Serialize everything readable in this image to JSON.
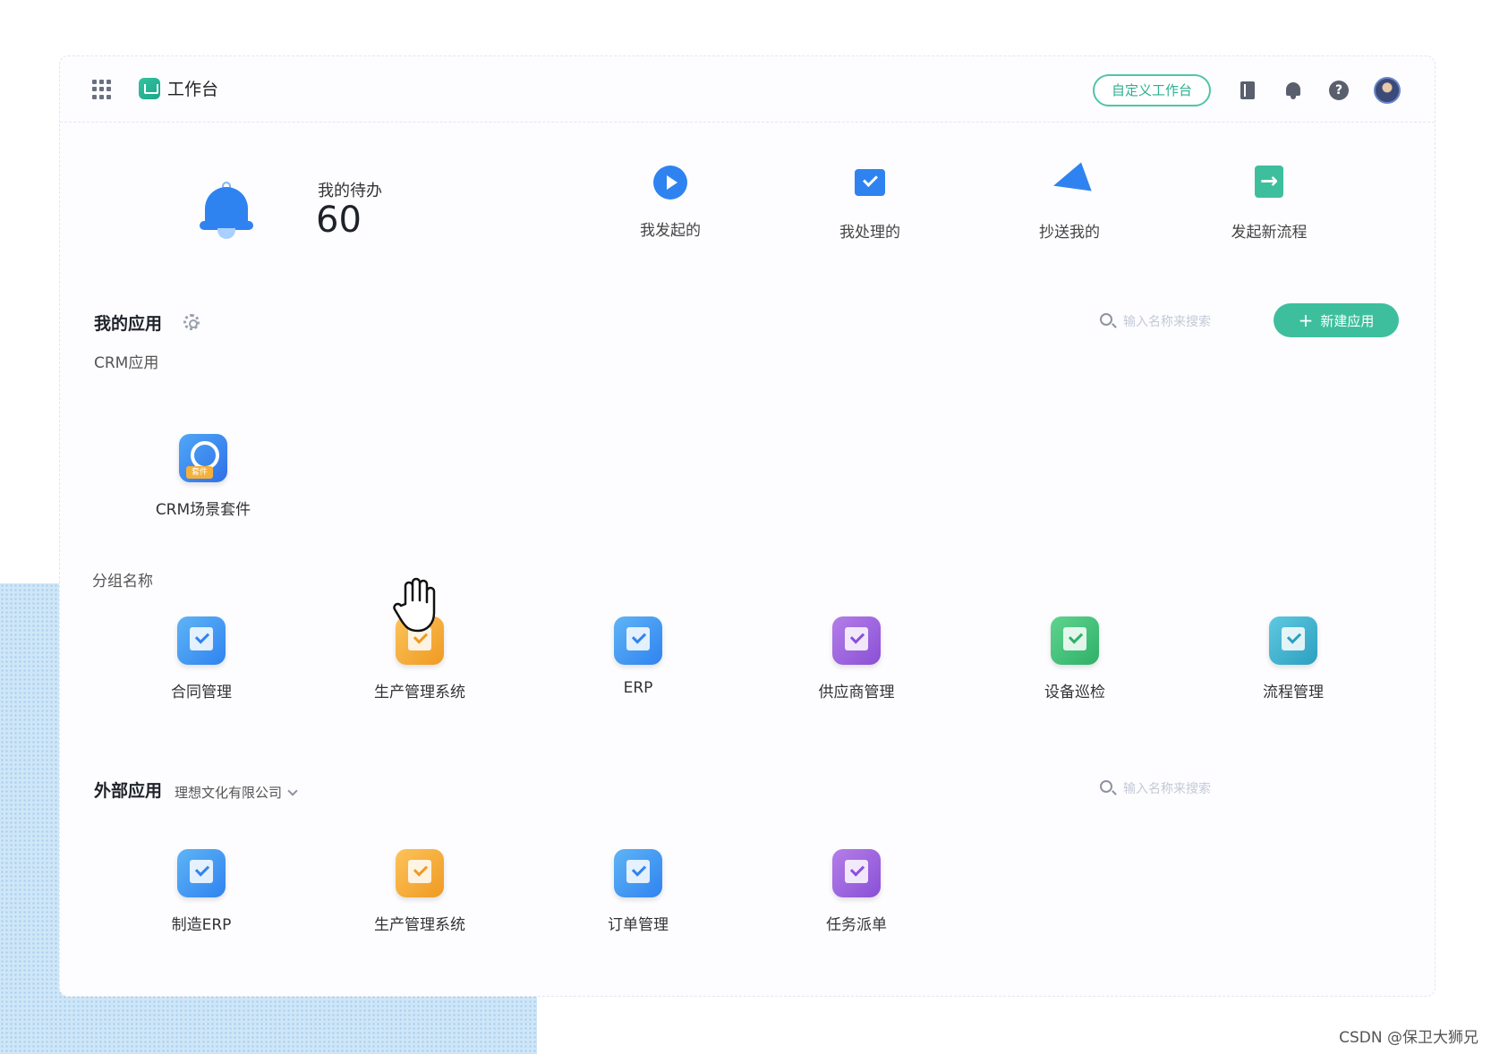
{
  "header": {
    "title": "工作台",
    "customize_label": "自定义工作台"
  },
  "todo": {
    "label": "我的待办",
    "count": "60"
  },
  "quick_actions": [
    {
      "label": "我发起的",
      "icon": "play-icon"
    },
    {
      "label": "我处理的",
      "icon": "check-box-icon"
    },
    {
      "label": "抄送我的",
      "icon": "paper-plane-icon"
    },
    {
      "label": "发起新流程",
      "icon": "new-flow-icon"
    }
  ],
  "my_apps": {
    "title": "我的应用",
    "search_placeholder": "输入名称来搜索",
    "new_app_label": "新建应用",
    "groups": [
      {
        "name": "CRM应用",
        "apps": [
          {
            "name": "CRM场景套件",
            "badge": "套件"
          }
        ]
      },
      {
        "name": "分组名称",
        "apps": [
          {
            "name": "合同管理",
            "color": "blue"
          },
          {
            "name": "生产管理系统",
            "color": "orange"
          },
          {
            "name": "ERP",
            "color": "blue"
          },
          {
            "name": "供应商管理",
            "color": "purple"
          },
          {
            "name": "设备巡检",
            "color": "green"
          },
          {
            "name": "流程管理",
            "color": "teal"
          }
        ]
      }
    ]
  },
  "external_apps": {
    "title": "外部应用",
    "company": "理想文化有限公司",
    "search_placeholder": "输入名称来搜索",
    "apps": [
      {
        "name": "制造ERP",
        "color": "blue"
      },
      {
        "name": "生产管理系统",
        "color": "orange"
      },
      {
        "name": "订单管理",
        "color": "blue"
      },
      {
        "name": "任务派单",
        "color": "purple"
      }
    ]
  },
  "watermark": "CSDN @保卫大狮兄",
  "colors": {
    "accent": "#3dbf9d",
    "primary_blue": "#2f83f0"
  }
}
